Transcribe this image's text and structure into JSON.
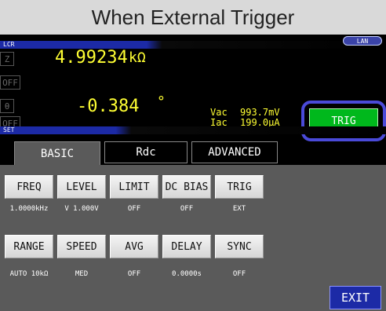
{
  "caption": "When External Trigger",
  "header": {
    "lcr_label": "LCR",
    "lan_label": "LAN"
  },
  "display": {
    "param1_label": "Z",
    "param1_value": "4.99234",
    "param1_unit": "kΩ",
    "param1_off": "OFF",
    "param2_label": "θ",
    "param2_value": "-0.384",
    "param2_unit": "°",
    "param2_off": "OFF"
  },
  "monitor": {
    "vac_label": "Vac",
    "vac_value": "993.7mV",
    "iac_label": "Iac",
    "iac_value": "199.0μA"
  },
  "trigger_button": {
    "label": "TRIG"
  },
  "set_section": {
    "label": "SET"
  },
  "tabs": [
    {
      "label": "BASIC",
      "active": true
    },
    {
      "label": "Rdc",
      "active": false
    },
    {
      "label": "ADVANCED",
      "active": false
    }
  ],
  "row1": [
    {
      "button": "FREQ",
      "value": "1.0000kHz"
    },
    {
      "button": "LEVEL",
      "value": "V 1.000V"
    },
    {
      "button": "LIMIT",
      "value": "OFF"
    },
    {
      "button": "DC BIAS",
      "value": "OFF"
    },
    {
      "button": "TRIG",
      "value": "EXT"
    }
  ],
  "row2": [
    {
      "button": "RANGE",
      "value": "AUTO  10kΩ"
    },
    {
      "button": "SPEED",
      "value": "MED"
    },
    {
      "button": "AVG",
      "value": "OFF"
    },
    {
      "button": "DELAY",
      "value": "0.0000s"
    },
    {
      "button": "SYNC",
      "value": "OFF"
    }
  ],
  "exit_button": {
    "label": "EXIT"
  },
  "colors": {
    "measurement_text": "#ffff33",
    "trig_button": "#00b81c",
    "trig_highlight": "#4a4ad8",
    "header_blue": "#1c2aa6",
    "panel_gray": "#5a5a5a"
  }
}
